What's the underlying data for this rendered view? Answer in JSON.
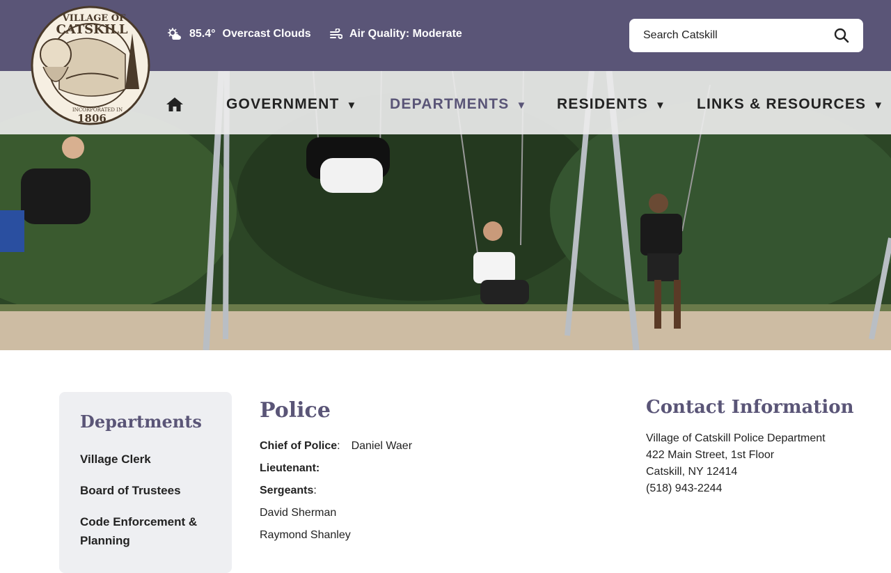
{
  "logo": {
    "line1": "VILLAGE OF",
    "line2": "CATSKILL",
    "incorporated": "INCORPORATED IN",
    "year": "1806"
  },
  "weather": {
    "icon": "partly-cloudy-icon",
    "temp": "85.4°",
    "condition": "Overcast Clouds"
  },
  "air_quality": {
    "icon": "wind-icon",
    "label": "Air Quality: Moderate"
  },
  "search": {
    "placeholder": "Search Catskill"
  },
  "nav": {
    "home_icon": "home-icon",
    "items": [
      {
        "label": "GOVERNMENT",
        "caret": "▼"
      },
      {
        "label": "DEPARTMENTS",
        "caret": "▼"
      },
      {
        "label": "RESIDENTS",
        "caret": "▼"
      },
      {
        "label": "LINKS & RESOURCES",
        "caret": "▼"
      }
    ]
  },
  "sidebar": {
    "title": "Departments",
    "items": [
      {
        "label": "Village Clerk"
      },
      {
        "label": "Board of Trustees"
      },
      {
        "label": "Code Enforcement & Planning"
      }
    ]
  },
  "page": {
    "title": "Police",
    "chief_label": "Chief of Police",
    "chief_colon": ":",
    "chief_value": "Daniel Waer",
    "lieutenant_label": "Lieutenant:",
    "sergeants_label": "Sergeants",
    "sergeants_colon": ":",
    "sergeants": [
      "David Sherman",
      "Raymond Shanley"
    ]
  },
  "contact": {
    "title": "Contact Information",
    "lines": [
      "Village of Catskill Police Department",
      "422 Main Street, 1st Floor",
      "Catskill, NY 12414",
      "(518) 943-2244"
    ]
  },
  "colors": {
    "brand": "#5a5577",
    "text": "#222222",
    "sidebar_bg": "#eeeff2"
  }
}
